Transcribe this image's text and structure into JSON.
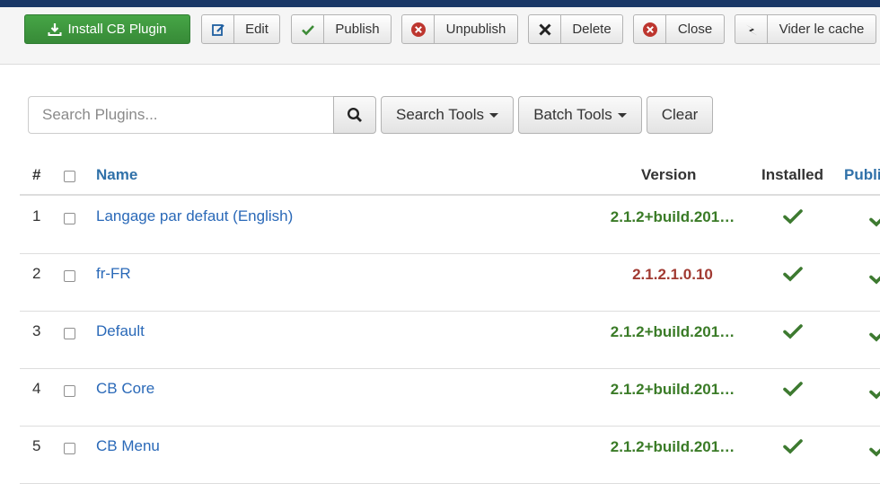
{
  "toolbar": {
    "install_label": "Install CB Plugin",
    "edit_label": "Edit",
    "publish_label": "Publish",
    "unpublish_label": "Unpublish",
    "delete_label": "Delete",
    "close_label": "Close",
    "clear_cache_label": "Vider le cache"
  },
  "filters": {
    "search_placeholder": "Search Plugins...",
    "search_value": "",
    "search_tools_label": "Search Tools",
    "batch_tools_label": "Batch Tools",
    "clear_label": "Clear"
  },
  "table": {
    "headers": {
      "num": "#",
      "name": "Name",
      "version": "Version",
      "installed": "Installed",
      "published": "Publi"
    },
    "rows": [
      {
        "num": "1",
        "name": "Langage par defaut (English)",
        "version": "2.1.2+build.201…",
        "version_status": "ok",
        "installed": "check-icon"
      },
      {
        "num": "2",
        "name": "fr-FR",
        "version": "2.1.2.1.0.10",
        "version_status": "outdated",
        "installed": "check-icon"
      },
      {
        "num": "3",
        "name": "Default",
        "version": "2.1.2+build.201…",
        "version_status": "ok",
        "installed": "check-icon"
      },
      {
        "num": "4",
        "name": "CB Core",
        "version": "2.1.2+build.201…",
        "version_status": "ok",
        "installed": "check-icon"
      },
      {
        "num": "5",
        "name": "CB Menu",
        "version": "2.1.2+build.201…",
        "version_status": "ok",
        "installed": "check-icon"
      }
    ]
  },
  "colors": {
    "topbar": "#1a3867",
    "install_button": "#46a546",
    "link": "#2a69b8",
    "version_ok": "#3a7b27",
    "version_outdated": "#a13a32",
    "check": "#3d7a30",
    "unpublish_icon": "#bd362f"
  }
}
